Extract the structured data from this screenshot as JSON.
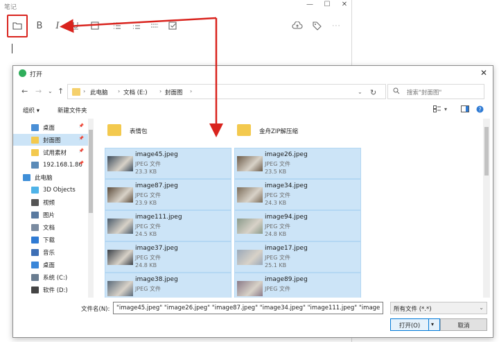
{
  "notes_app": {
    "title": "笔记",
    "window_controls": [
      "—",
      "☐",
      "✕"
    ],
    "toolbar": [
      "folder-icon",
      "bold",
      "italic",
      "underline",
      "image",
      "list-bullets",
      "list-numbers",
      "divider",
      "checkbox",
      "cloud-upload",
      "tag",
      "more"
    ],
    "bold_label": "B",
    "italic_label": "I",
    "highlight_color": "#d9231d"
  },
  "dialog": {
    "title": "打开",
    "breadcrumb": [
      "此电脑",
      "文档 (E:)",
      "封面图"
    ],
    "search_placeholder": "搜索\"封面图\"",
    "organize_label": "组织 ▾",
    "new_folder_label": "新建文件夹",
    "sidebar": [
      {
        "label": "桌面",
        "pinned": true,
        "color": "#4a8fd6"
      },
      {
        "label": "封面图",
        "pinned": true,
        "selected": true,
        "color": "#f3c94e"
      },
      {
        "label": "试用素材",
        "pinned": true,
        "color": "#f3c94e"
      },
      {
        "label": "192.168.1.86",
        "pinned": true,
        "color": "#5b8bb8"
      },
      {
        "label": "此电脑",
        "color": "#3f8fd8"
      },
      {
        "label": "3D Objects",
        "color": "#4fb3e8"
      },
      {
        "label": "视频",
        "color": "#555555"
      },
      {
        "label": "图片",
        "color": "#5a7aa0"
      },
      {
        "label": "文档",
        "color": "#7a8ba0"
      },
      {
        "label": "下载",
        "color": "#2f7bd4"
      },
      {
        "label": "音乐",
        "color": "#3d6fb5"
      },
      {
        "label": "桌面",
        "color": "#3a86d8"
      },
      {
        "label": "系统 (C:)",
        "color": "#6a7d90"
      },
      {
        "label": "软件 (D:)",
        "color": "#444444"
      }
    ],
    "folders": [
      {
        "name": "表情包"
      },
      {
        "name": "金舟ZIP解压缩"
      }
    ],
    "files": [
      {
        "name": "image45.jpeg",
        "type": "JPEG 文件",
        "size": "23.3 KB",
        "thumb": "#3b4a5a"
      },
      {
        "name": "image26.jpeg",
        "type": "JPEG 文件",
        "size": "23.5 KB",
        "thumb": "#6b5a48"
      },
      {
        "name": "image87.jpeg",
        "type": "JPEG 文件",
        "size": "23.9 KB",
        "thumb": "#5a4a3a"
      },
      {
        "name": "image34.jpeg",
        "type": "JPEG 文件",
        "size": "24.3 KB",
        "thumb": "#7a6b58"
      },
      {
        "name": "image111.jpeg",
        "type": "JPEG 文件",
        "size": "24.5 KB",
        "thumb": "#4a5a6a"
      },
      {
        "name": "image94.jpeg",
        "type": "JPEG 文件",
        "size": "24.8 KB",
        "thumb": "#8a9a8a"
      },
      {
        "name": "image37.jpeg",
        "type": "JPEG 文件",
        "size": "24.8 KB",
        "thumb": "#3a4048"
      },
      {
        "name": "image17.jpeg",
        "type": "JPEG 文件",
        "size": "25.1 KB",
        "thumb": "#9aa8b8"
      },
      {
        "name": "image38.jpeg",
        "type": "JPEG 文件",
        "size": "",
        "thumb": "#5a6a7a"
      },
      {
        "name": "image89.jpeg",
        "type": "JPEG 文件",
        "size": "",
        "thumb": "#8a7a88"
      }
    ],
    "filename_label": "文件名(N):",
    "filename_value": "\"image45.jpeg\" \"image26.jpeg\" \"image87.jpeg\" \"image34.jpeg\" \"image111.jpeg\" \"image",
    "filetype_value": "所有文件 (*.*)",
    "open_label": "打开(O)",
    "cancel_label": "取消",
    "selection_color": "#cce4f7"
  }
}
